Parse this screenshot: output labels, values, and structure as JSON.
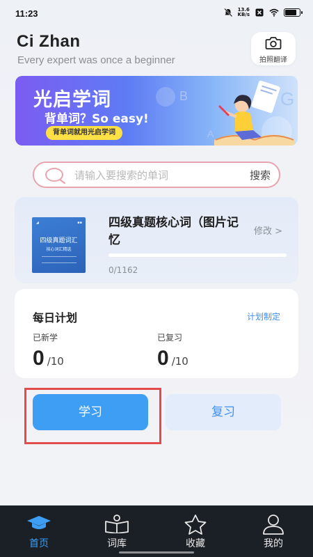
{
  "status_bar": {
    "time": "11:23",
    "net_speed_value": "13.6",
    "net_speed_unit": "KB/s",
    "icons": [
      "mute-icon",
      "close-box-icon",
      "wifi-icon",
      "battery-icon"
    ],
    "battery_level": 0.8
  },
  "header": {
    "title": "Ci Zhan",
    "subtitle": "Every expert was once a beginner",
    "photo_translate_label": "拍照翻译",
    "photo_translate_icon": "camera-icon"
  },
  "banner": {
    "title": "光启学词",
    "slogan": "背单词？So easy!",
    "tag": "背单词就用光启学词"
  },
  "search": {
    "placeholder": "请输入要搜索的单词",
    "button_label": "搜索"
  },
  "book": {
    "title": "四级真题核心词（图片记忆",
    "modify_label": "修改 >",
    "progress_text": "0/1162",
    "progress_fraction": 0,
    "cover_title": "四级真题词汇",
    "cover_subtitle": "核心词汇精选"
  },
  "plan": {
    "title": "每日计划",
    "set_label": "计划制定",
    "learned_label": "已新学",
    "learned_value": "0",
    "learned_total": "/10",
    "reviewed_label": "已复习",
    "reviewed_value": "0",
    "reviewed_total": "/10"
  },
  "actions": {
    "learn_label": "学习",
    "review_label": "复习"
  },
  "nav": {
    "items": [
      {
        "label": "首页",
        "icon": "graduation-cap-icon",
        "active": true
      },
      {
        "label": "词库",
        "icon": "book-reader-icon",
        "active": false
      },
      {
        "label": "收藏",
        "icon": "star-icon",
        "active": false
      },
      {
        "label": "我的",
        "icon": "user-icon",
        "active": false
      }
    ]
  },
  "colors": {
    "accent": "#3d9ef4",
    "highlight_border": "#e14b4b",
    "search_border": "#e8a4ae",
    "nav_background": "#1b1f26"
  }
}
